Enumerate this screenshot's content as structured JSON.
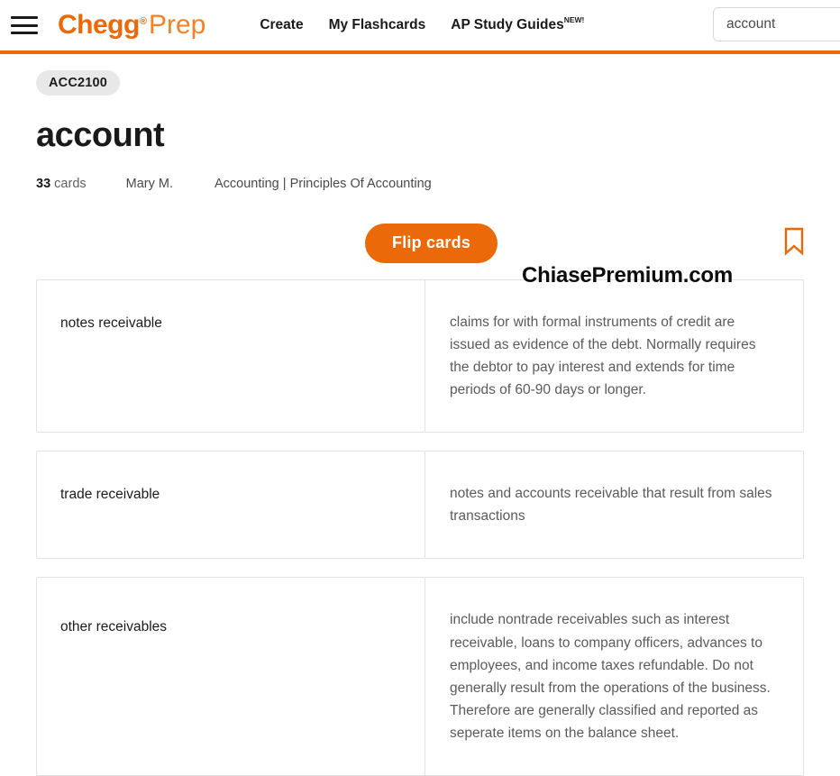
{
  "header": {
    "menu_icon": "hamburger-menu-icon",
    "logo": {
      "brand": "Chegg",
      "registered": "®",
      "product": "Prep"
    },
    "nav": [
      {
        "label": "Create",
        "badge": ""
      },
      {
        "label": "My Flashcards",
        "badge": ""
      },
      {
        "label": "AP Study Guides",
        "badge": "NEW!"
      }
    ],
    "search": {
      "value": "account",
      "placeholder": "Search"
    },
    "accent_color": "#ec6909"
  },
  "deck": {
    "course_badge": "ACC2100",
    "title": "account",
    "card_count": "33",
    "card_count_label": "cards",
    "author": "Mary M.",
    "subject": "Accounting | Principles Of Accounting"
  },
  "actions": {
    "flip_label": "Flip cards",
    "bookmark_icon": "bookmark-icon"
  },
  "watermark": "ChiasePremium.com",
  "cards": [
    {
      "term": "notes receivable",
      "definition": "claims for with formal instruments of credit are issued as evidence of the debt. Normally requires the debtor to pay interest and extends for time periods of 60-90 days or longer."
    },
    {
      "term": "trade receivable",
      "definition": "notes and accounts receivable that result from sales transactions"
    },
    {
      "term": "other receivables",
      "definition": "include nontrade receivables such as interest receivable, loans to company officers, advances to employees, and income taxes refundable. Do not generally result from the operations of the business. Therefore are generally classified and reported as seperate items on the balance sheet."
    }
  ]
}
